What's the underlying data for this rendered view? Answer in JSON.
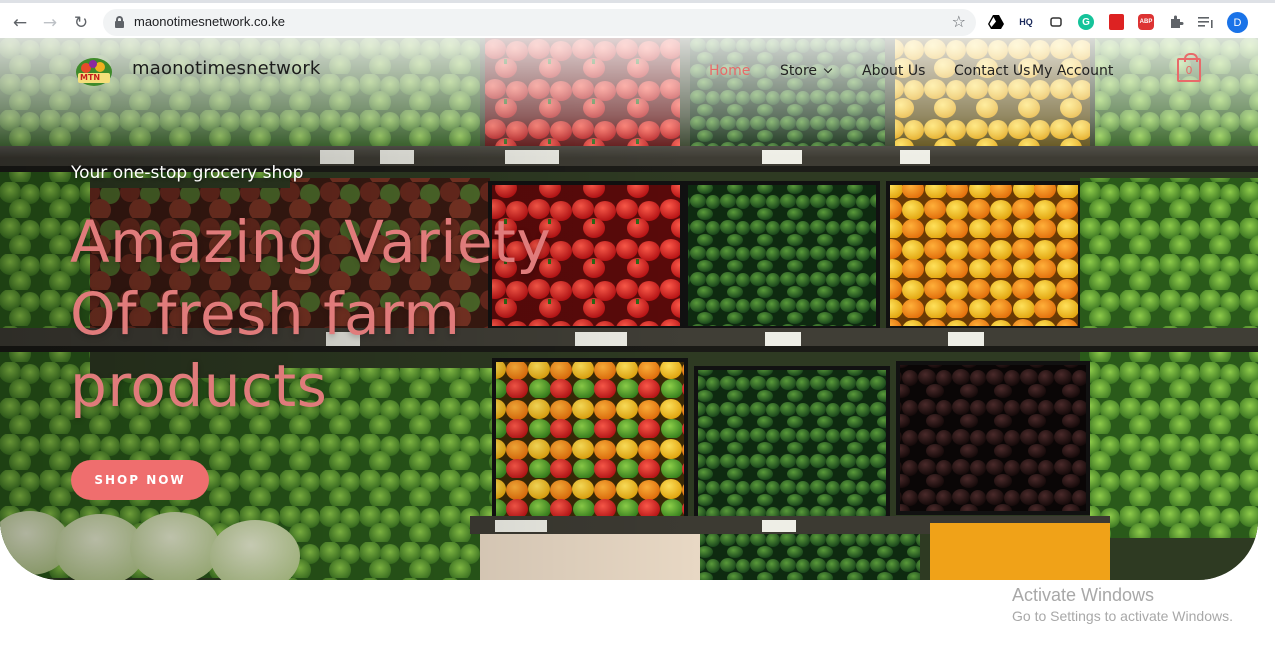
{
  "browser": {
    "url": "maonotimesnetwork.co.ke",
    "profile_initial": "D",
    "ext_hq_label": "HQ",
    "ext_abp_label": "ABP"
  },
  "site": {
    "name": "maonotimesnetwork",
    "logo_text": "MTN",
    "nav": [
      {
        "label": "Home",
        "active": true
      },
      {
        "label": "Store",
        "dropdown": true
      },
      {
        "label": "About Us"
      },
      {
        "label": "Contact Us"
      },
      {
        "label": "My Account"
      }
    ],
    "cart_count": "0",
    "accent_color": "#e86a6a"
  },
  "hero": {
    "tagline": "Your one-stop grocery shop",
    "headline_lines": [
      "Amazing Variety",
      "Of fresh farm",
      "products"
    ],
    "cta_label": "SHOP NOW",
    "background": "produce shelves with peppers, cucumbers, lettuce and herbs"
  },
  "overlay": {
    "activate_title": "Activate Windows",
    "activate_sub": "Go to Settings to activate Windows."
  }
}
